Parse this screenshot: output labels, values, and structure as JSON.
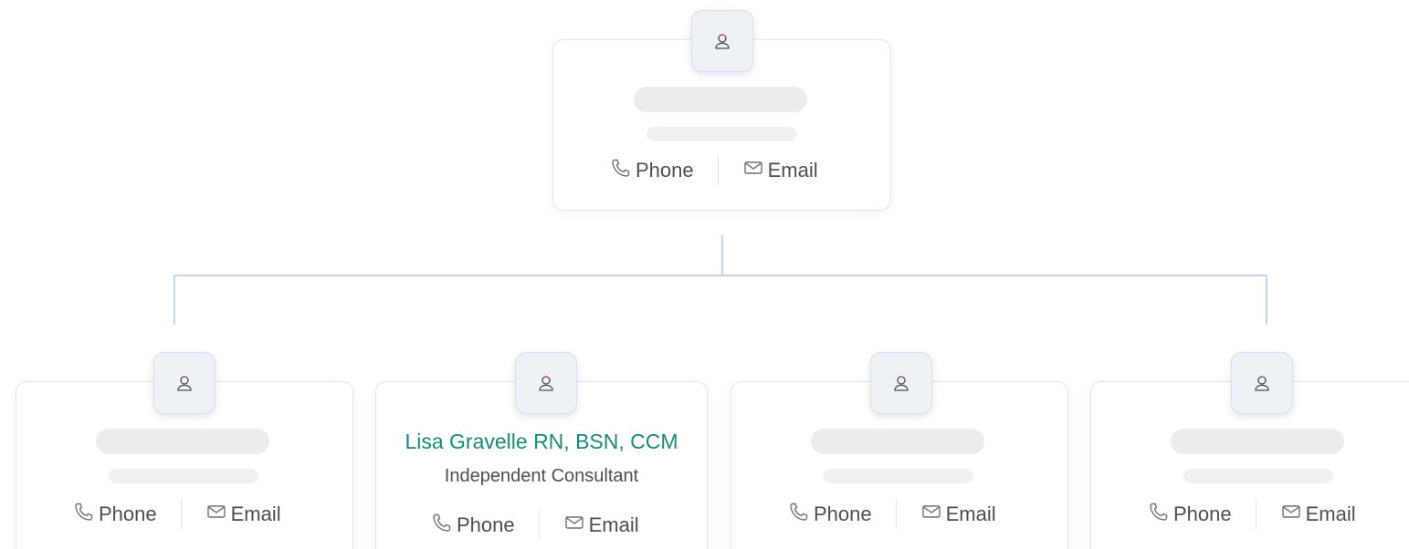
{
  "top_card": {
    "phone_label": "Phone",
    "email_label": "Email"
  },
  "child_cards": [
    {
      "name": "",
      "role": "",
      "phone_label": "Phone",
      "email_label": "Email"
    },
    {
      "name": "Lisa Gravelle RN, BSN, CCM",
      "role": "Independent Consultant",
      "phone_label": "Phone",
      "email_label": "Email"
    },
    {
      "name": "",
      "role": "",
      "phone_label": "Phone",
      "email_label": "Email"
    },
    {
      "name": "",
      "role": "",
      "phone_label": "Phone",
      "email_label": "Email"
    }
  ],
  "icons": {
    "avatar": "user-avatar-icon",
    "phone": "phone-icon",
    "email": "envelope-icon"
  },
  "colors": {
    "name_accent": "#1a8a7a",
    "connector": "#c4d4ea",
    "skeleton": "#ececec"
  }
}
